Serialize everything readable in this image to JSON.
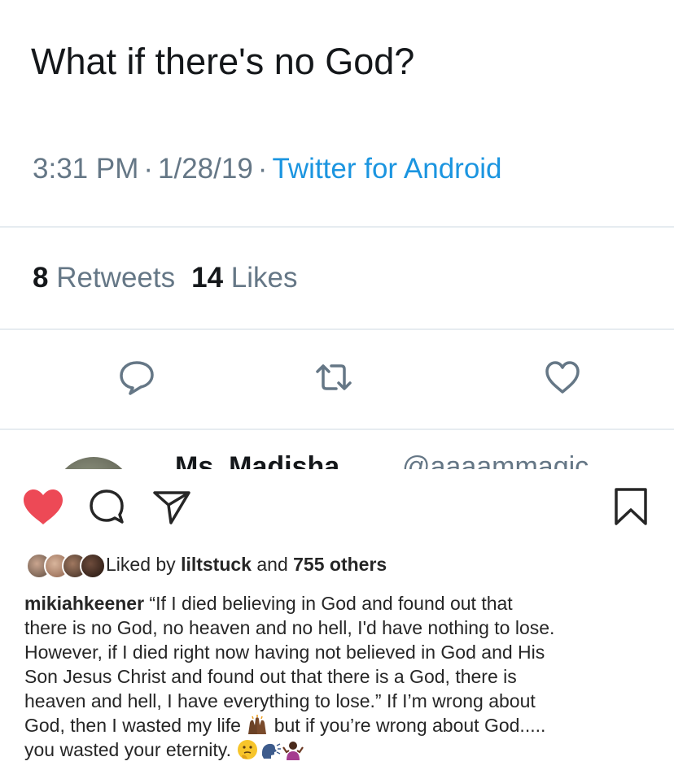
{
  "tweet": {
    "text": "What if there's no God?",
    "time": "3:31 PM",
    "date": "1/28/19",
    "separator": "·",
    "source": "Twitter for Android",
    "retweets_count": "8",
    "retweets_label": "Retweets",
    "likes_count": "14",
    "likes_label": "Likes",
    "icons": {
      "reply": "reply-icon",
      "retweet": "retweet-icon",
      "like": "heart-outline-icon"
    },
    "colors": {
      "text": "#14171a",
      "secondary": "#657786",
      "link": "#1b95e0",
      "divider": "#e6ecf0"
    }
  },
  "next_tweet": {
    "name": "Ms. Madisha",
    "handle": "@aaaammagic"
  },
  "instagram": {
    "icons": {
      "like": "heart-filled-icon",
      "comment": "comment-icon",
      "share": "direct-share-icon",
      "save": "bookmark-icon"
    },
    "colors": {
      "like": "#ed4956",
      "text": "#262626"
    },
    "likes": {
      "prefix": "Liked by",
      "user": "liltstuck",
      "middle": "and",
      "others": "755 others"
    },
    "caption": {
      "username": "mikiahkeener",
      "text_part1": "“If I died believing in God and found out that\nthere is no God, no heaven and no hell, I'd have nothing to lose.\nHowever, if I died right now having not believed in God and His\nSon Jesus Christ and found out that there is a God, there is\nheaven and hell, I have everything to lose.” If I’m wrong about\nGod, then I wasted my life",
      "text_part2": "but if you’re wrong about God.....\nyou wasted your eternity.",
      "emoji_names": [
        "raised-hands-emoji",
        "thinking-face-emoji",
        "speaking-head-emoji",
        "woman-shrugging-emoji"
      ]
    }
  }
}
